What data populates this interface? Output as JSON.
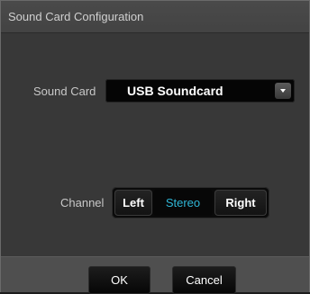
{
  "dialog": {
    "title": "Sound Card Configuration"
  },
  "sound_card": {
    "label": "Sound Card",
    "selected": "USB Soundcard"
  },
  "channel": {
    "label": "Channel",
    "options": [
      "Left",
      "Stereo",
      "Right"
    ],
    "selected": "Stereo",
    "selected_color": "#2fb6d6"
  },
  "buttons": {
    "ok": "OK",
    "cancel": "Cancel"
  }
}
